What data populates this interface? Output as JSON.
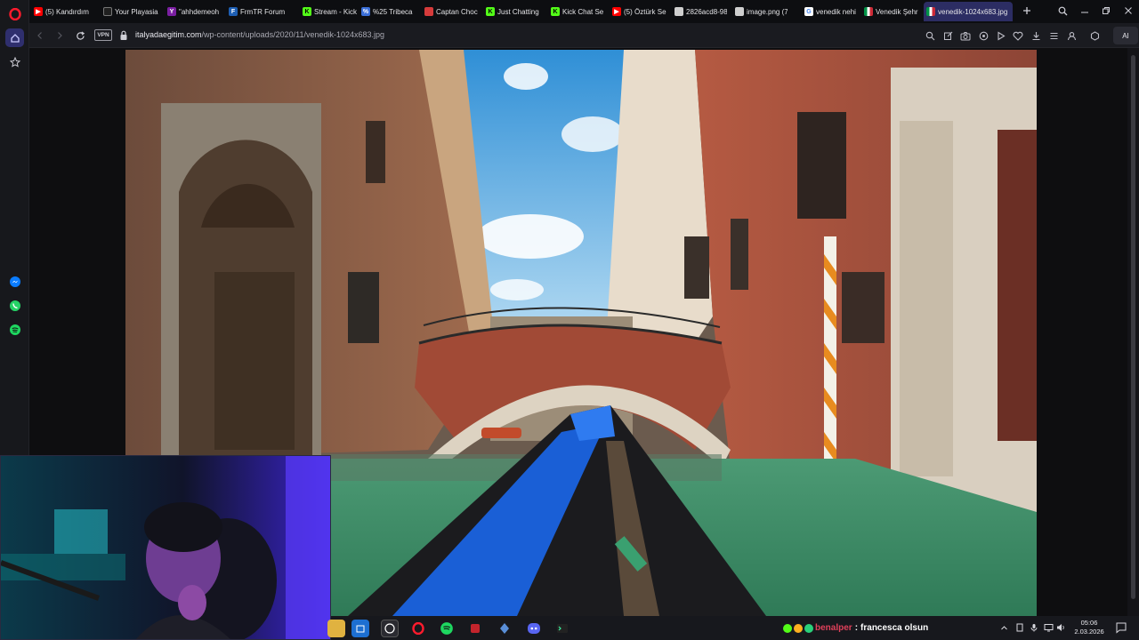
{
  "browser": {
    "tabs": [
      {
        "title": "(5) Kandırdım",
        "icon": "youtube-icon",
        "color": "#ff0000"
      },
      {
        "title": "Your Playasia",
        "icon": "playasia-icon",
        "color": "#202020"
      },
      {
        "title": "\"ahhdemeoh",
        "icon": "yahoo-icon",
        "color": "#7b1fa2"
      },
      {
        "title": "FrmTR Forum",
        "icon": "forum-icon",
        "color": "#1e5fb4"
      },
      {
        "title": "Stream - Kick",
        "icon": "kick-icon",
        "color": "#53fc18"
      },
      {
        "title": "%25 Tribeca",
        "icon": "tribeca-icon",
        "color": "#3b6fd8"
      },
      {
        "title": "Captan Choc",
        "icon": "captan-icon",
        "color": "#d63b3b"
      },
      {
        "title": "Just Chatting",
        "icon": "kick-icon",
        "color": "#53fc18"
      },
      {
        "title": "Kick Chat Se",
        "icon": "kick-icon",
        "color": "#53fc18"
      },
      {
        "title": "(5) Öztürk Se",
        "icon": "youtube-icon",
        "color": "#ff0000"
      },
      {
        "title": "2826acd8-98",
        "icon": "file-icon",
        "color": "#cfcfcf"
      },
      {
        "title": "image.png (7",
        "icon": "file-icon",
        "color": "#cfcfcf"
      },
      {
        "title": "venedik nehi",
        "icon": "google-icon",
        "color": "#ffffff"
      },
      {
        "title": "Venedik Şehr",
        "icon": "italy-flag-icon",
        "color": "#009246"
      },
      {
        "title": "venedik-1024x683.jpg",
        "icon": "italy-flag-icon",
        "color": "#009246",
        "active": true
      }
    ],
    "url_domain": "italyadaegitim.com",
    "url_path": "/wp-content/uploads/2020/11/venedik-1024x683.jpg",
    "vpn_label": "VPN",
    "ai_label": "AI"
  },
  "taskbar": {
    "chat_user": "benalper",
    "chat_separator": ":",
    "chat_message": "francesca olsun",
    "time": "05:06",
    "date": "2.03.2026"
  },
  "colors": {
    "accent": "#2c2d63",
    "kick_green": "#53fc18",
    "chat_user": "#e0405a"
  }
}
